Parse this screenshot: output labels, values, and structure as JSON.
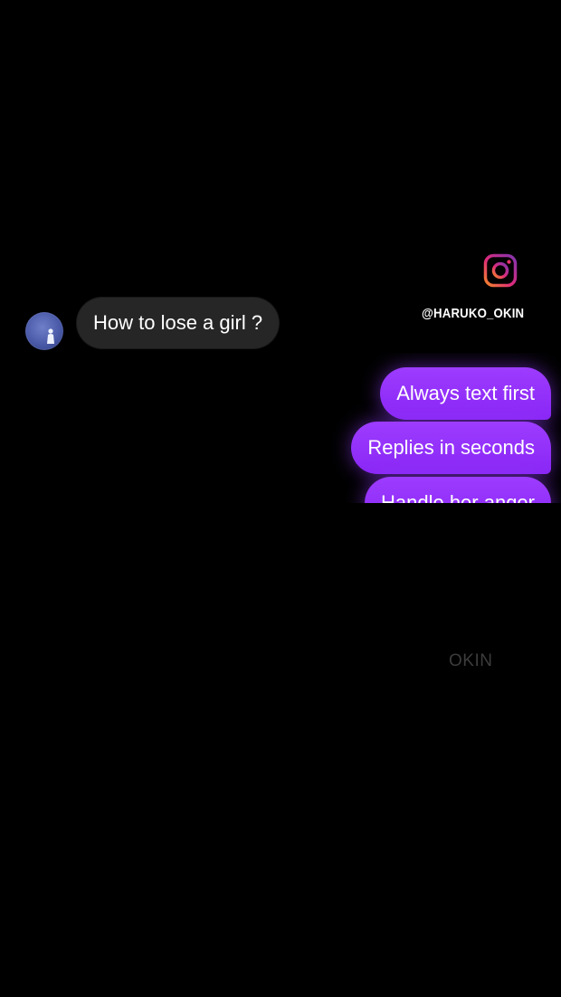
{
  "instagram": {
    "icon": "instagram-icon",
    "handle": "@HARUKO_OKIN"
  },
  "chat": {
    "incoming": {
      "avatar": "avatar",
      "text": "How to lose a girl ?"
    },
    "outgoing": [
      {
        "text": "Always text first"
      },
      {
        "text": "Replies in seconds"
      },
      {
        "text": "Handle her anger"
      }
    ]
  },
  "watermark": "OKIN",
  "colors": {
    "background": "#000000",
    "incoming_bubble": "#262626",
    "outgoing_bubble": "#9a37ff",
    "instagram_gradient": [
      "#f58529",
      "#dd2a7b",
      "#8134af"
    ]
  }
}
